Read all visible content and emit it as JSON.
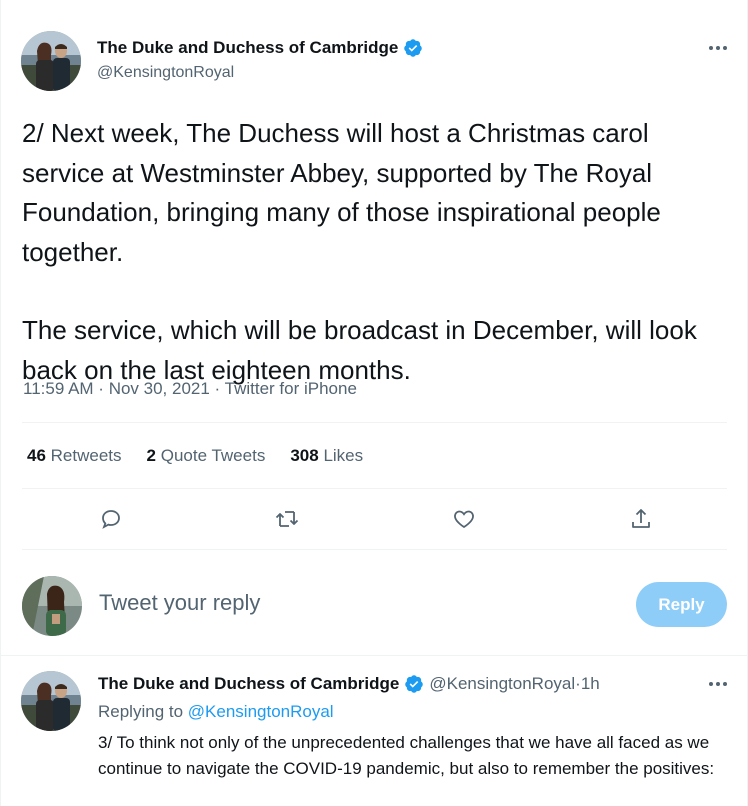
{
  "main_tweet": {
    "author_name": "The Duke and Duchess of Cambridge",
    "handle": "@KensingtonRoyal",
    "text_p1": "2/ Next week, The Duchess will host a Christmas carol service at Westminster Abbey, supported by The Royal Foundation, bringing many of those inspirational people together.",
    "text_p2": "The service, which will be broadcast in December, will look back on the last eighteen months.",
    "time": "11:59 AM",
    "date": "Nov 30, 2021",
    "source": "Twitter for iPhone",
    "separator": " · "
  },
  "stats": {
    "retweets_count": "46",
    "retweets_label": "Retweets",
    "quotes_count": "2",
    "quotes_label": "Quote Tweets",
    "likes_count": "308",
    "likes_label": "Likes"
  },
  "actions": [
    "reply-icon",
    "retweet-icon",
    "like-icon",
    "share-icon"
  ],
  "composer": {
    "placeholder": "Tweet your reply",
    "button_label": "Reply"
  },
  "next_tweet": {
    "author_name": "The Duke and Duchess of Cambridge",
    "handle": "@KensingtonRoyal",
    "separator": " · ",
    "age": "1h",
    "replying_prefix": "Replying to",
    "replying_to": "@KensingtonRoyal",
    "text": "3/ To think not only of the unprecedented challenges that we have all faced as we continue to navigate the COVID-19 pandemic, but also to remember the positives:"
  },
  "colors": {
    "accent": "#1d9bf0",
    "reply_button_disabled": "#8ecdf8",
    "secondary_text": "#536471",
    "border": "#eff3f4"
  }
}
